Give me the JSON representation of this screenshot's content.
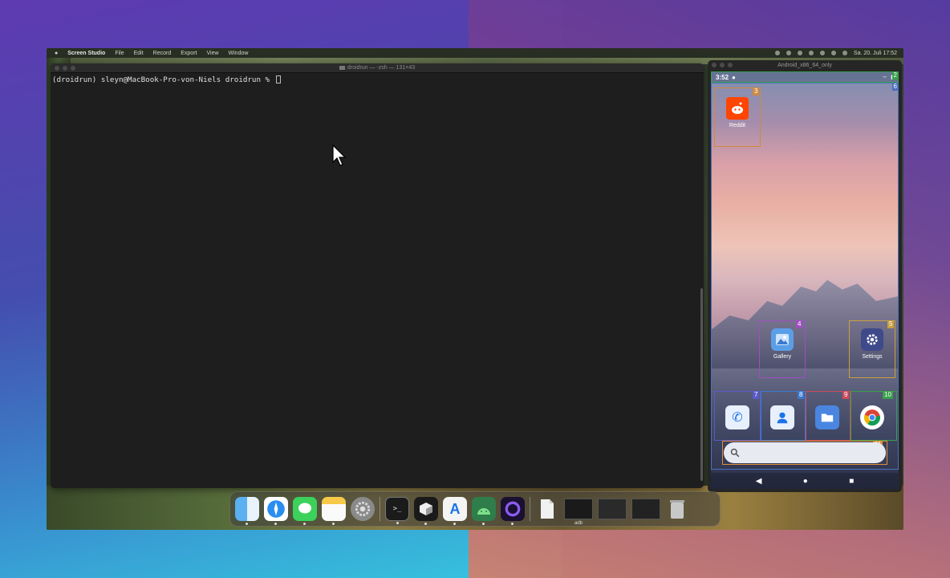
{
  "menubar": {
    "app": "Screen Studio",
    "items": [
      "File",
      "Edit",
      "Record",
      "Export",
      "View",
      "Window"
    ],
    "clock": "Sa. 20. Juli 17:52"
  },
  "terminal": {
    "title": "droidrun — -zsh — 131×43",
    "prompt": "(droidrun) sleyn@MacBook-Pro-von-Niels droidrun % "
  },
  "emulator": {
    "title": "Android_x86_64_only",
    "status_time": "3:52",
    "apps": {
      "reddit": "Reddit",
      "gallery": "Gallery",
      "settings": "Settings"
    },
    "tags": {
      "status": "2",
      "root": "6",
      "reddit": "3",
      "gallery": "4",
      "settings": "5",
      "phone": "7",
      "contacts": "8",
      "files": "9",
      "chrome": "10",
      "search": "11"
    },
    "colors": {
      "reddit_box": "#d08a3a",
      "gallery_box": "#a04fc0",
      "settings_box": "#c9a040",
      "phone_box": "#5a5ac8",
      "contacts_box": "#3a7ad0",
      "files_box": "#d04a5a",
      "chrome_box": "#3aa04a",
      "search_box": "#e0903a"
    }
  },
  "dock": {
    "thumb_label": "adb"
  }
}
